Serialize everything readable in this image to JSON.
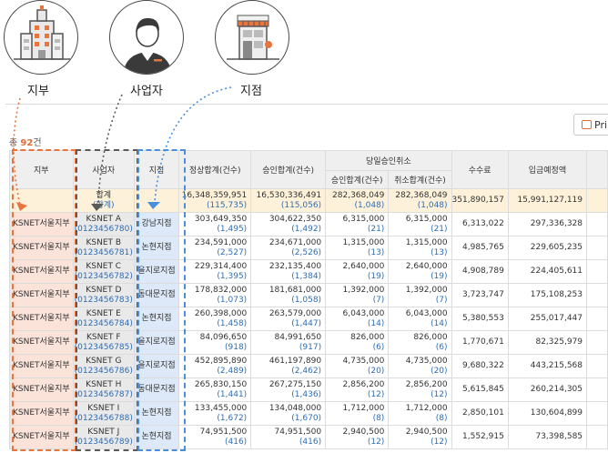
{
  "labels": {
    "region": "지부",
    "business": "사업자",
    "branch": "지점"
  },
  "toolbar": {
    "print_label": "Prin",
    "total_prefix": "총 ",
    "total_count": "92",
    "total_suffix": "건"
  },
  "headers": {
    "region": "지부",
    "business": "사업자",
    "branch": "지점",
    "normal_total": "정상합계(건수)",
    "approve_total": "승인합계(건수)",
    "sameday_cancel": "당일승인취소",
    "cancel_approve": "승인합계(건수)",
    "cancel_cancel": "취소합계(건수)",
    "fee": "수수료",
    "deposit": "입금예정액"
  },
  "summary": {
    "label": "합계",
    "label_sub": "(합계)",
    "normal": "16,348,359,951",
    "normal_cnt": "(115,735)",
    "approve": "16,530,336,491",
    "approve_cnt": "(115,056)",
    "c_approve": "282,368,049",
    "c_approve_cnt": "(1,048)",
    "c_cancel": "282,368,049",
    "c_cancel_cnt": "(1,048)",
    "fee": "351,890,157",
    "deposit": "15,991,127,119"
  },
  "rows": [
    {
      "region": "KSNET서울지부",
      "biz": "KSNET A",
      "bizno": "(0123456780)",
      "branch": "강남지점",
      "normal": "303,649,350",
      "normal_cnt": "(1,495)",
      "approve": "304,622,350",
      "approve_cnt": "(1,492)",
      "c_approve": "6,315,000",
      "c_approve_cnt": "(21)",
      "c_cancel": "6,315,000",
      "c_cancel_cnt": "(21)",
      "fee": "6,313,022",
      "deposit": "297,336,328"
    },
    {
      "region": "KSNET서울지부",
      "biz": "KSNET B",
      "bizno": "(0123456781)",
      "branch": "논현지점",
      "normal": "234,591,000",
      "normal_cnt": "(2,527)",
      "approve": "234,671,000",
      "approve_cnt": "(2,526)",
      "c_approve": "1,315,000",
      "c_approve_cnt": "(13)",
      "c_cancel": "1,315,000",
      "c_cancel_cnt": "(13)",
      "fee": "4,985,765",
      "deposit": "229,605,235"
    },
    {
      "region": "KSNET서울지부",
      "biz": "KSNET C",
      "bizno": "(0123456782)",
      "branch": "을지로지점",
      "normal": "229,314,400",
      "normal_cnt": "(1,395)",
      "approve": "232,135,400",
      "approve_cnt": "(1,384)",
      "c_approve": "2,640,000",
      "c_approve_cnt": "(19)",
      "c_cancel": "2,640,000",
      "c_cancel_cnt": "(19)",
      "fee": "4,908,789",
      "deposit": "224,405,611"
    },
    {
      "region": "KSNET서울지부",
      "biz": "KSNET D",
      "bizno": "(0123456783)",
      "branch": "동대문지점",
      "normal": "178,832,000",
      "normal_cnt": "(1,073)",
      "approve": "181,681,000",
      "approve_cnt": "(1,058)",
      "c_approve": "1,392,000",
      "c_approve_cnt": "(7)",
      "c_cancel": "1,392,000",
      "c_cancel_cnt": "(7)",
      "fee": "3,723,747",
      "deposit": "175,108,253"
    },
    {
      "region": "KSNET서울지부",
      "biz": "KSNET E",
      "bizno": "(0123456784)",
      "branch": "논현지점",
      "normal": "260,398,000",
      "normal_cnt": "(1,458)",
      "approve": "263,579,000",
      "approve_cnt": "(1,447)",
      "c_approve": "6,043,000",
      "c_approve_cnt": "(14)",
      "c_cancel": "6,043,000",
      "c_cancel_cnt": "(14)",
      "fee": "5,380,553",
      "deposit": "255,017,447"
    },
    {
      "region": "KSNET서울지부",
      "biz": "KSNET F",
      "bizno": "(0123456785)",
      "branch": "을지로지점",
      "normal": "84,096,650",
      "normal_cnt": "(918)",
      "approve": "84,991,650",
      "approve_cnt": "(917)",
      "c_approve": "826,000",
      "c_approve_cnt": "(6)",
      "c_cancel": "826,000",
      "c_cancel_cnt": "(6)",
      "fee": "1,770,671",
      "deposit": "82,325,979"
    },
    {
      "region": "KSNET서울지부",
      "biz": "KSNET G",
      "bizno": "(0123456786)",
      "branch": "을지로지점",
      "normal": "452,895,890",
      "normal_cnt": "(2,489)",
      "approve": "461,197,890",
      "approve_cnt": "(2,462)",
      "c_approve": "4,735,000",
      "c_approve_cnt": "(20)",
      "c_cancel": "4,735,000",
      "c_cancel_cnt": "(20)",
      "fee": "9,680,322",
      "deposit": "443,215,568"
    },
    {
      "region": "KSNET서울지부",
      "biz": "KSNET H",
      "bizno": "(0123456787)",
      "branch": "동대문지점",
      "normal": "265,830,150",
      "normal_cnt": "(1,441)",
      "approve": "267,275,150",
      "approve_cnt": "(1,436)",
      "c_approve": "2,856,200",
      "c_approve_cnt": "(12)",
      "c_cancel": "2,856,200",
      "c_cancel_cnt": "(12)",
      "fee": "5,615,845",
      "deposit": "260,214,305"
    },
    {
      "region": "KSNET서울지부",
      "biz": "KSNET I",
      "bizno": "(0123456788)",
      "branch": "논현지점",
      "normal": "133,455,000",
      "normal_cnt": "(1,672)",
      "approve": "134,048,000",
      "approve_cnt": "(1,670)",
      "c_approve": "1,712,000",
      "c_approve_cnt": "(8)",
      "c_cancel": "1,712,000",
      "c_cancel_cnt": "(8)",
      "fee": "2,850,101",
      "deposit": "130,604,899"
    },
    {
      "region": "KSNET서울지부",
      "biz": "KSNET J",
      "bizno": "(0123456789)",
      "branch": "논현지점",
      "normal": "74,951,500",
      "normal_cnt": "(416)",
      "approve": "74,951,500",
      "approve_cnt": "(416)",
      "c_approve": "2,940,500",
      "c_approve_cnt": "(12)",
      "c_cancel": "2,940,500",
      "c_cancel_cnt": "(12)",
      "fee": "1,552,915",
      "deposit": "73,398,585"
    }
  ],
  "colors": {
    "region_accent": "#e8753e",
    "business_accent": "#5a5a5a",
    "branch_accent": "#4a8fdc",
    "count_blue": "#2f6db5"
  }
}
